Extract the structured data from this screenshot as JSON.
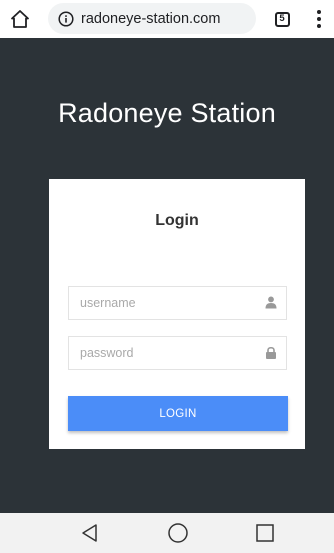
{
  "browser": {
    "url": "radoneye-station.com",
    "tab_count": "5",
    "icons": [
      "home-icon",
      "info-icon",
      "tab-switcher-icon",
      "overflow-menu-icon"
    ]
  },
  "page": {
    "title": "Radoneye Station",
    "background_color": "#2c3338"
  },
  "login": {
    "heading": "Login",
    "username_placeholder": "username",
    "password_placeholder": "password",
    "button_label": "LOGIN",
    "button_color": "#4b8df8",
    "icons": [
      "user-icon",
      "lock-icon"
    ]
  },
  "system_nav": {
    "icons": [
      "back-icon",
      "home-circle-icon",
      "recents-icon"
    ]
  }
}
